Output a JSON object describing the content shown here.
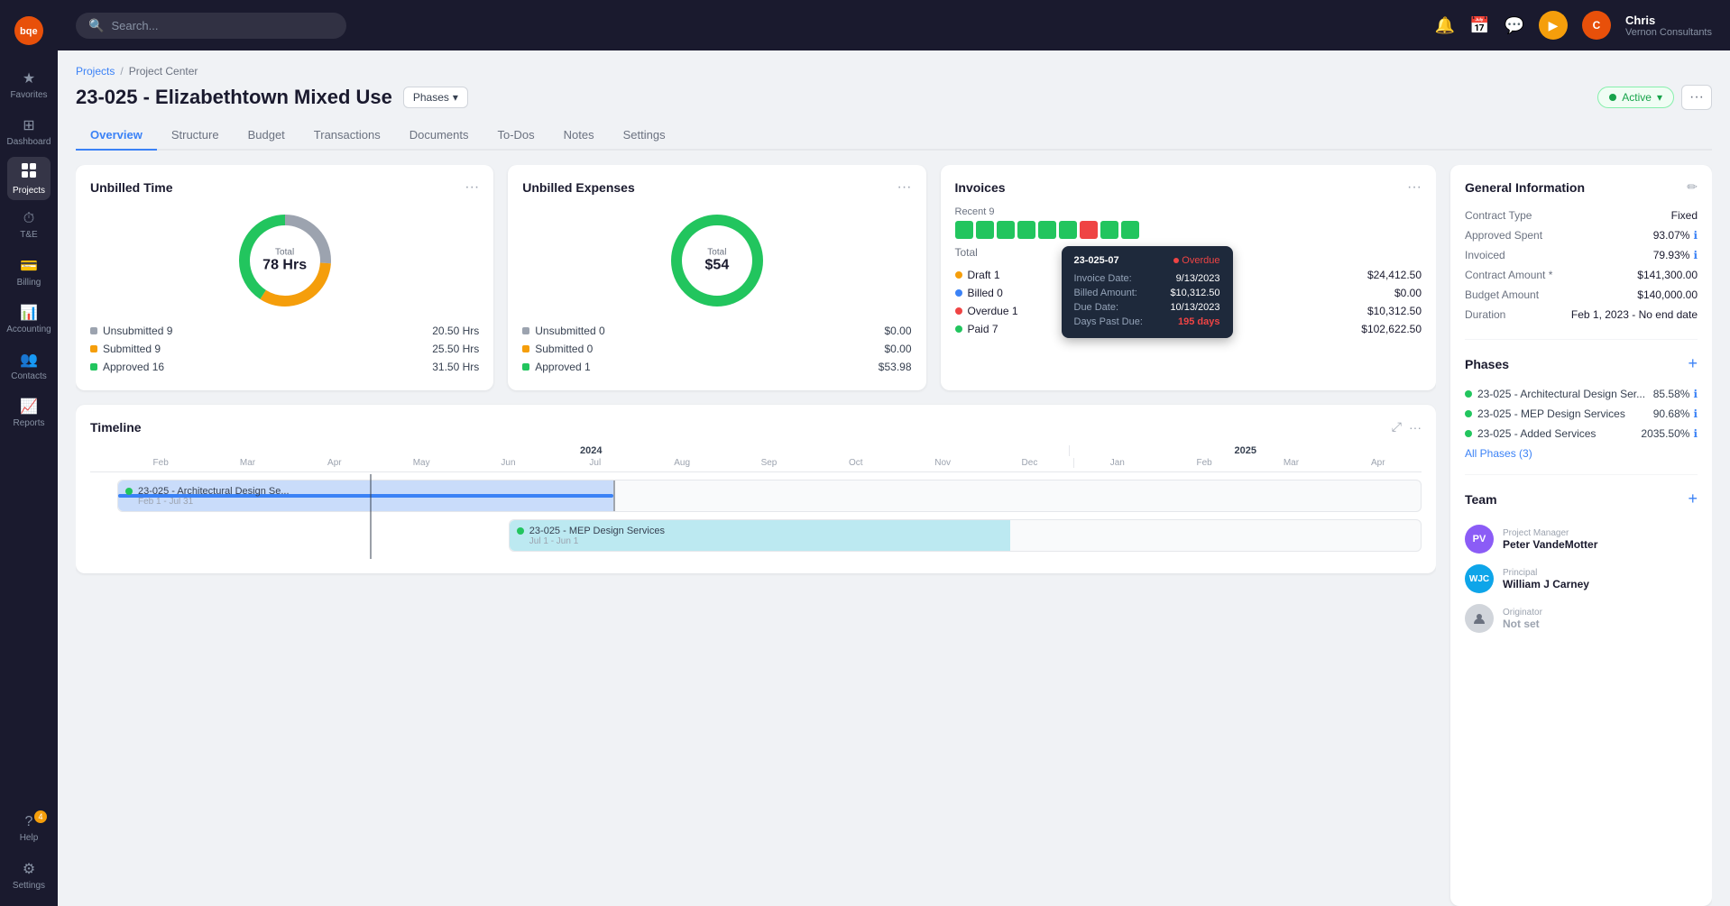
{
  "app": {
    "logo": "bqe",
    "logo_bg": "#e8500a"
  },
  "sidebar": {
    "items": [
      {
        "id": "favorites",
        "label": "Favorites",
        "icon": "★"
      },
      {
        "id": "dashboard",
        "label": "Dashboard",
        "icon": "⊞"
      },
      {
        "id": "projects",
        "label": "Projects",
        "icon": "📁",
        "active": true
      },
      {
        "id": "t-e",
        "label": "T&E",
        "icon": "⏱"
      },
      {
        "id": "billing",
        "label": "Billing",
        "icon": "💳"
      },
      {
        "id": "accounting",
        "label": "Accounting",
        "icon": "📊"
      },
      {
        "id": "contacts",
        "label": "Contacts",
        "icon": "👥"
      },
      {
        "id": "reports",
        "label": "Reports",
        "icon": "📈"
      }
    ],
    "bottom_items": [
      {
        "id": "help",
        "label": "Help",
        "icon": "?",
        "badge": "4"
      },
      {
        "id": "settings",
        "label": "Settings",
        "icon": "⚙"
      }
    ]
  },
  "topnav": {
    "search_placeholder": "Search...",
    "user": {
      "name": "Chris",
      "company": "Vernon Consultants",
      "initials": "C"
    }
  },
  "breadcrumb": {
    "items": [
      "Projects",
      "Project Center"
    ]
  },
  "project": {
    "title": "23-025 - Elizabethtown Mixed Use",
    "phases_btn": "Phases",
    "status": "Active"
  },
  "tabs": [
    "Overview",
    "Structure",
    "Budget",
    "Transactions",
    "Documents",
    "To-Dos",
    "Notes",
    "Settings"
  ],
  "active_tab": "Overview",
  "unbilled_time": {
    "title": "Unbilled Time",
    "total_label": "Total",
    "total_value": "78 Hrs",
    "stats": [
      {
        "label": "Unsubmitted",
        "count": 9,
        "value": "20.50 Hrs",
        "color": "#9ca3af"
      },
      {
        "label": "Submitted",
        "count": 9,
        "value": "25.50 Hrs",
        "color": "#f59e0b"
      },
      {
        "label": "Approved",
        "count": 16,
        "value": "31.50 Hrs",
        "color": "#22c55e"
      }
    ],
    "donut": {
      "segments": [
        {
          "pct": 26,
          "color": "#9ca3af"
        },
        {
          "pct": 33,
          "color": "#f59e0b"
        },
        {
          "pct": 41,
          "color": "#22c55e"
        }
      ]
    }
  },
  "unbilled_expenses": {
    "title": "Unbilled Expenses",
    "total_label": "Total",
    "total_value": "$54",
    "stats": [
      {
        "label": "Unsubmitted",
        "count": 0,
        "value": "$0.00",
        "color": "#9ca3af"
      },
      {
        "label": "Submitted",
        "count": 0,
        "value": "$0.00",
        "color": "#f59e0b"
      },
      {
        "label": "Approved",
        "count": 1,
        "value": "$53.98",
        "color": "#22c55e"
      }
    ],
    "donut": {
      "segments": [
        {
          "pct": 100,
          "color": "#22c55e"
        }
      ]
    }
  },
  "invoices": {
    "title": "Invoices",
    "recent_label": "Recent",
    "recent_count": 9,
    "squares": [
      "paid",
      "paid",
      "paid",
      "paid",
      "paid",
      "paid",
      "overdue",
      "paid",
      "paid"
    ],
    "total_label": "Total",
    "rows": [
      {
        "label": "Draft",
        "count": 1,
        "value": "$24,412.50",
        "color": "#f59e0b"
      },
      {
        "label": "Billed",
        "count": 0,
        "value": "$0.00",
        "color": "#3b82f6"
      },
      {
        "label": "Overdue",
        "count": 1,
        "value": "$10,312.50",
        "color": "#ef4444"
      },
      {
        "label": "Paid",
        "count": 7,
        "value": "$102,622.50",
        "color": "#22c55e"
      }
    ],
    "tooltip": {
      "id": "23-025-07",
      "status": "Overdue",
      "invoice_date_label": "Invoice Date:",
      "invoice_date": "9/13/2023",
      "billed_amount_label": "Billed Amount:",
      "billed_amount": "$10,312.50",
      "due_date_label": "Due Date:",
      "due_date": "10/13/2023",
      "days_past_due_label": "Days Past Due:",
      "days_past_due": "195 days"
    }
  },
  "timeline": {
    "title": "Timeline",
    "years": [
      "2024",
      "2025"
    ],
    "months_2024": [
      "Feb",
      "Mar",
      "Apr",
      "May",
      "Jun",
      "Jul",
      "Aug",
      "Sep",
      "Oct",
      "Nov",
      "Dec"
    ],
    "months_2025": [
      "Jan",
      "Feb",
      "Mar",
      "Apr"
    ],
    "bars": [
      {
        "label": "23-025 - Architectural Design Se...",
        "date": "Feb 1 - Jul 31",
        "color": "blue",
        "width_pct": 35,
        "left_pct": 0
      },
      {
        "label": "23-025 - MEP Design Services",
        "date": "Jul 1 - Jun 1",
        "color": "teal",
        "width_pct": 20,
        "left_pct": 32
      }
    ]
  },
  "right_panel": {
    "general_info": {
      "title": "General Information",
      "rows": [
        {
          "label": "Contract Type",
          "value": "Fixed"
        },
        {
          "label": "Approved Spent",
          "value": "93.07%",
          "icon": true
        },
        {
          "label": "Invoiced",
          "value": "79.93%",
          "icon": true
        },
        {
          "label": "Contract Amount *",
          "value": "$141,300.00"
        },
        {
          "label": "Budget Amount",
          "value": "$140,000.00"
        },
        {
          "label": "Duration",
          "value": "Feb 1, 2023 - No end date"
        }
      ]
    },
    "phases": {
      "title": "Phases",
      "items": [
        {
          "label": "23-025 - Architectural Design Ser...",
          "pct": "85.58%",
          "icon": true
        },
        {
          "label": "23-025 - MEP Design Services",
          "pct": "90.68%",
          "icon": true
        },
        {
          "label": "23-025 - Added Services",
          "pct": "2035.50%",
          "icon": true
        }
      ],
      "all_phases_label": "All Phases (3)"
    },
    "team": {
      "title": "Team",
      "members": [
        {
          "role": "Project Manager",
          "name": "Peter VandeMotter",
          "initials": "PV",
          "color": "#8b5cf6"
        },
        {
          "role": "Principal",
          "name": "William J Carney",
          "initials": "WJC",
          "color": "#0ea5e9"
        },
        {
          "role": "Originator",
          "name": "Not set",
          "initials": "",
          "color": "#9ca3af"
        }
      ]
    }
  }
}
